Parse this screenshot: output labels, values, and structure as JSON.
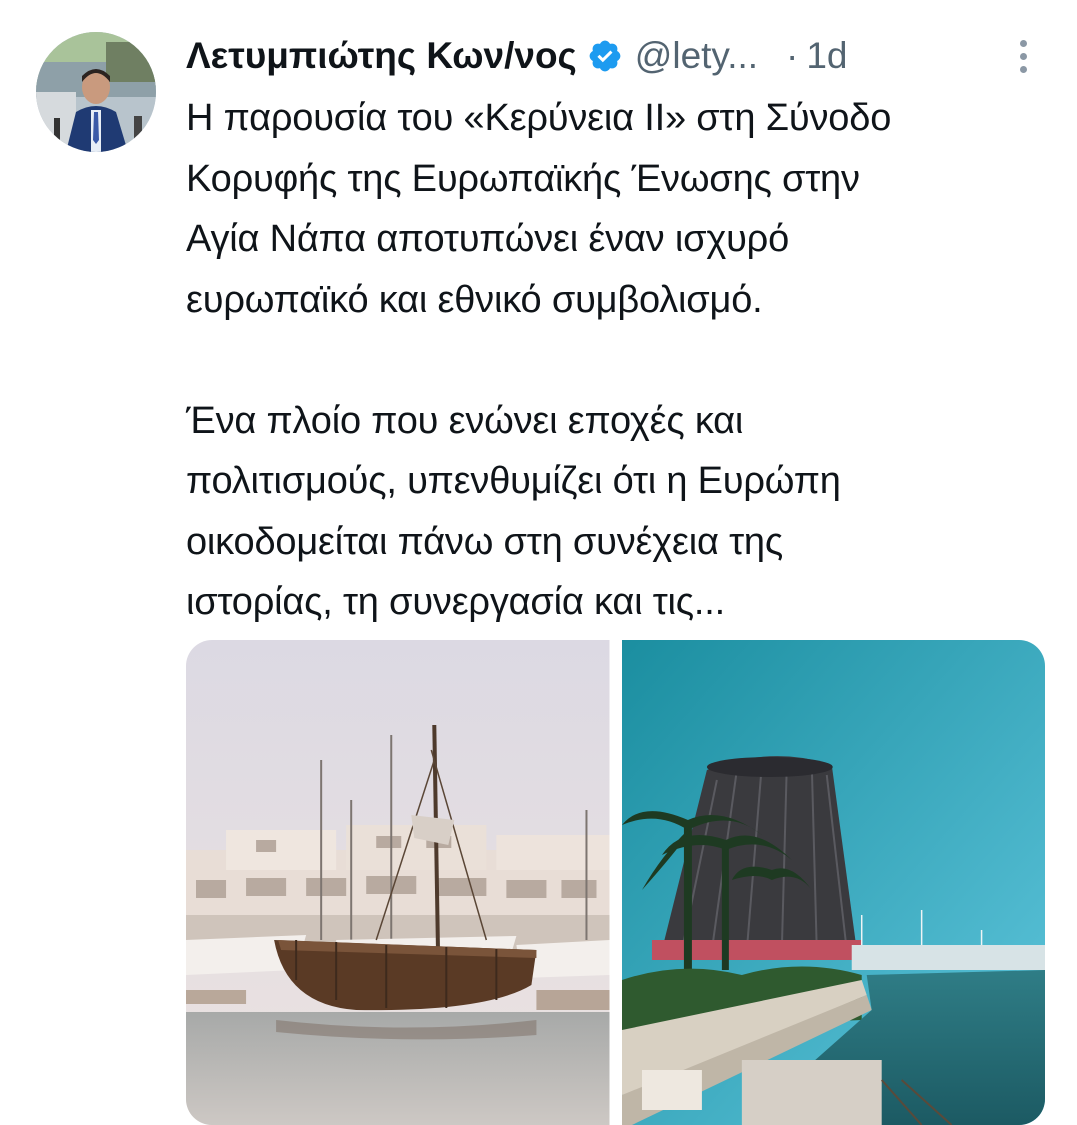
{
  "tweet": {
    "author_name": "Λετυμπιώτης Κων/νος",
    "handle": "@lety...",
    "separator": "·",
    "time": "1d",
    "text_lines_p1": [
      "Η παρουσία του «Κερύνεια ΙΙ» στη Σύνοδο",
      "Κορυφής της Ευρωπαϊκής Ένωσης στην",
      "Αγία Νάπα αποτυπώνει έναν ισχυρό",
      "ευρωπαϊκό και εθνικό συμβολισμό."
    ],
    "text_lines_p2": [
      "Ένα πλοίο που ενώνει εποχές και",
      "πολιτισμούς, υπενθυμίζει ότι η Ευρώπη",
      "οικοδομείται πάνω στη συνέχεια της",
      "ιστορίας, τη συνεργασία και τις..."
    ],
    "icons": {
      "verified": "verified-badge-icon",
      "more": "more-vertical-icon"
    },
    "colors": {
      "verified": "#1d9bf0",
      "secondary_text": "#536471",
      "primary_text": "#0f1419"
    },
    "media_count": 2
  }
}
